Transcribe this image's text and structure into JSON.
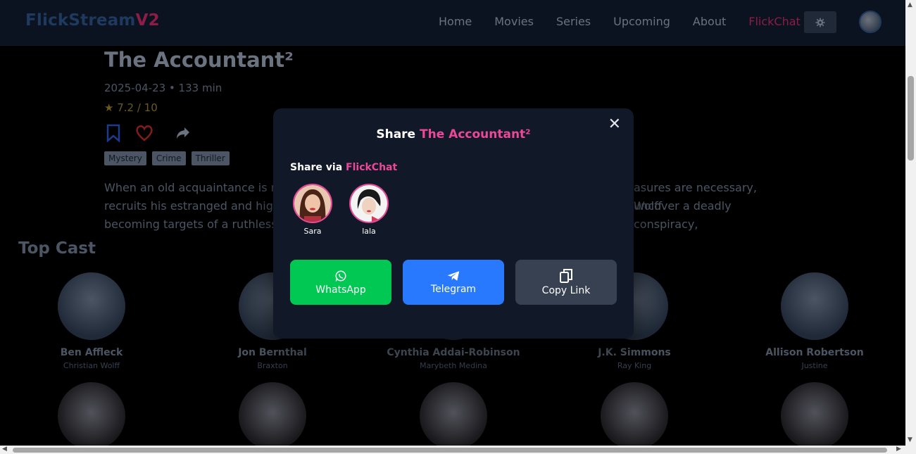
{
  "app": {
    "logo_part1": "FlickStream",
    "logo_part2": "V2",
    "nav": [
      "Home",
      "Movies",
      "Series",
      "Upcoming",
      "About"
    ],
    "nav_chat": "FlickChat"
  },
  "movie": {
    "title": "The Accountant²",
    "meta": "2025-04-23 • 133 min",
    "rating": "★ 7.2 / 10",
    "genres": [
      "Mystery",
      "Crime",
      "Thriller"
    ],
    "overview_line1": "When an old acquaintance is murc",
    "overview_line1b": "asures are necessary, Wolff",
    "overview_line2": "recruits his estranged and highly l",
    "overview_line2b": "uncover a deadly conspiracy,",
    "overview_line3": "becoming targets of a ruthless ne"
  },
  "cast_section": {
    "title": "Top Cast",
    "members": [
      {
        "name": "Ben Affleck",
        "role": "Christian Wolff"
      },
      {
        "name": "Jon Bernthal",
        "role": "Braxton"
      },
      {
        "name": "Cynthia Addai-Robinson",
        "role": "Marybeth Medina"
      },
      {
        "name": "J.K. Simmons",
        "role": "Ray King"
      },
      {
        "name": "Allison Robertson",
        "role": "Justine"
      }
    ]
  },
  "share_modal": {
    "title_prefix": "Share ",
    "title_movie": "The Accountant²",
    "close": "✕",
    "via_prefix": "Share via ",
    "via_app": "FlickChat",
    "friends": [
      {
        "name": "Sara"
      },
      {
        "name": "lala"
      }
    ],
    "buttons": {
      "whatsapp": "WhatsApp",
      "telegram": "Telegram",
      "copy": "Copy Link"
    }
  },
  "colors": {
    "accent": "#ec4899",
    "whatsapp": "#00c853",
    "telegram": "#2979ff",
    "modal_bg": "#111827"
  },
  "icons": [
    "gear-icon",
    "bookmark-icon",
    "heart-icon",
    "share-icon",
    "close-icon",
    "whatsapp-icon",
    "telegram-icon",
    "copy-icon"
  ]
}
